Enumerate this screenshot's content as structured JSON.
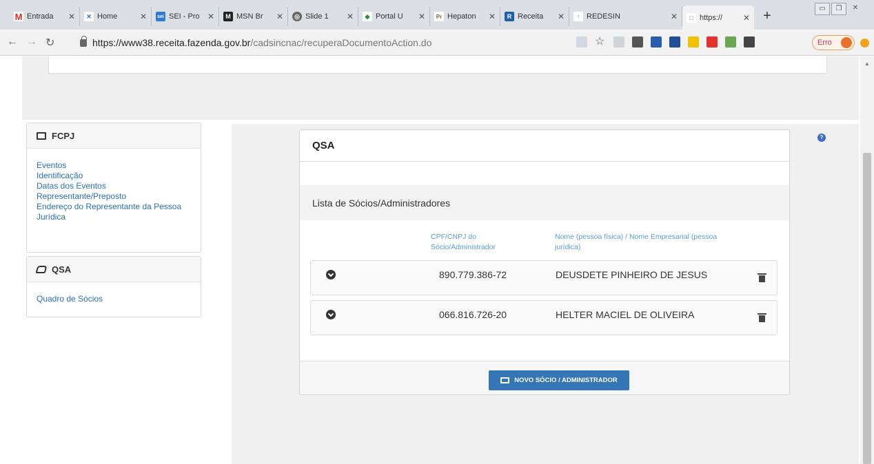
{
  "browser": {
    "tabs": [
      {
        "label": "Entrada",
        "icon_color": "#ffffff",
        "glyph": "M",
        "glyph_color": "#d93025"
      },
      {
        "label": "Home",
        "icon_color": "#ffffff",
        "glyph": "✕",
        "glyph_color": "#2d6bd4"
      },
      {
        "label": "SEI - Pro",
        "icon_color": "#2e7bd0",
        "glyph": "sei",
        "glyph_color": "#ffffff"
      },
      {
        "label": "MSN Br",
        "icon_color": "#222222",
        "glyph": "M",
        "glyph_color": "#ffffff"
      },
      {
        "label": "Slide 1",
        "icon_color": "#666666",
        "glyph": "◎",
        "glyph_color": "#ffffff"
      },
      {
        "label": "Portal U",
        "icon_color": "#ffffff",
        "glyph": "◆",
        "glyph_color": "#2f8f3a"
      },
      {
        "label": "Hepaton",
        "icon_color": "#ffffff",
        "glyph": "Pr",
        "glyph_color": "#8a5a2b"
      },
      {
        "label": "Receita",
        "icon_color": "#1d5fa8",
        "glyph": "R",
        "glyph_color": "#ffffff"
      },
      {
        "label": "REDESIN",
        "icon_color": "#ffffff",
        "glyph": "↑",
        "glyph_color": "#4aa0d8"
      },
      {
        "label": "https://",
        "icon_color": "#ffffff",
        "glyph": "□",
        "glyph_color": "#888888"
      }
    ],
    "new_tab": "+",
    "url_host": "https://www38.receita.fazenda.gov.br",
    "url_path": "/cadsincnac/recuperaDocumentoAction.do",
    "error_label": "Erro",
    "extension_colors": [
      "#cfd8e3",
      "#555555",
      "#2a5db0",
      "#1f4e9a",
      "#f2c200",
      "#e5322d",
      "#6aa84f",
      "#444444"
    ]
  },
  "sidebar": {
    "fcpj": {
      "title": "FCPJ",
      "links": [
        "Eventos",
        "Identificação",
        "Datas dos Eventos",
        "Representante/Preposto",
        "Endereço do Representante da Pessoa Jurídica"
      ]
    },
    "qsa": {
      "title": "QSA",
      "links": [
        "Quadro de Sócios"
      ]
    }
  },
  "main": {
    "card_title": "QSA",
    "list_title": "Lista de Sócios/Administradores",
    "col_cpf": "CPF/CNPJ do Sócio/Administrador",
    "col_nome": "Nome (pessoa física) / Nome Empresarial (pessoa jurídica)",
    "rows": [
      {
        "cpf": "890.779.386-72",
        "nome": "DEUSDETE PINHEIRO DE JESUS"
      },
      {
        "cpf": "066.816.726-20",
        "nome": "HELTER MACIEL DE OLIVEIRA"
      }
    ],
    "add_button": "NOVO SÓCIO / ADMINISTRADOR"
  },
  "colors": {
    "link": "#2a6fb6",
    "column_header": "#5b9bd5",
    "primary_button": "#3576b6"
  }
}
